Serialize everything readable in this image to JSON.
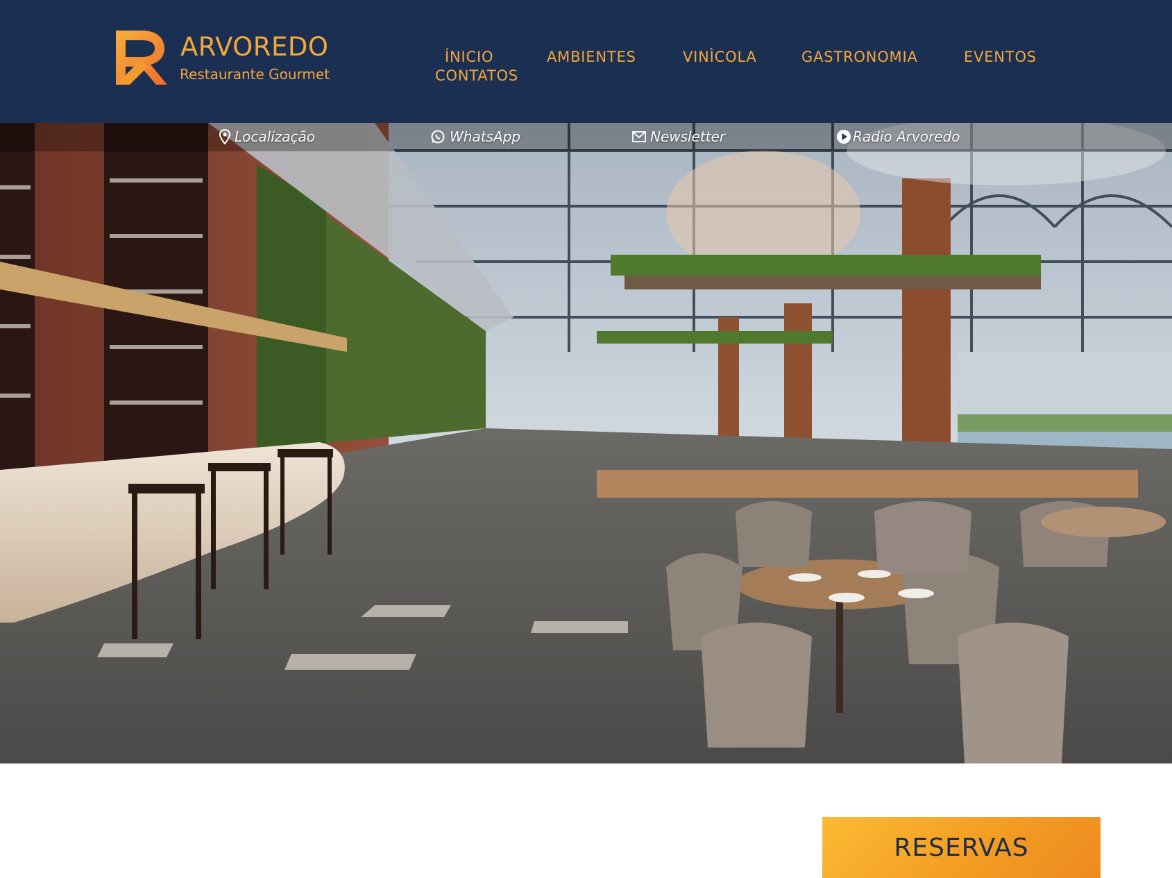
{
  "brand": {
    "name": "ARVOREDO",
    "tagline": "Restaurante Gourmet",
    "accent_color": "#f4a73a",
    "header_bg": "#1b2f52"
  },
  "nav": {
    "items": [
      "ÍNICIO",
      "AMBIENTES",
      "VINÌCOLA",
      "GASTRONOMIA",
      "EVENTOS",
      "CONTATOS"
    ]
  },
  "topbar": {
    "location": {
      "label": "Localização",
      "icon": "map-pin-icon"
    },
    "whatsapp": {
      "label": "WhatsApp",
      "icon": "whatsapp-icon"
    },
    "newsletter": {
      "label": "Newsletter",
      "icon": "envelope-icon"
    },
    "radio": {
      "label": "Radio Arvoredo",
      "icon": "play-icon"
    }
  },
  "reservations": {
    "label": "RESERVAS",
    "color": "#f39b23"
  }
}
